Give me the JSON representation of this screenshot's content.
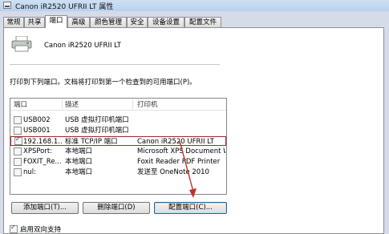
{
  "window": {
    "title": "Canon iR2520 UFRII LT 属性"
  },
  "tabs": [
    {
      "label": "常规"
    },
    {
      "label": "共享"
    },
    {
      "label": "端口"
    },
    {
      "label": "高级"
    },
    {
      "label": "颜色管理"
    },
    {
      "label": "安全"
    },
    {
      "label": "设备设置"
    },
    {
      "label": "配置文件"
    }
  ],
  "active_tab": "端口",
  "printer": {
    "name": "Canon iR2520 UFRII LT"
  },
  "instructions": "打印到下列端口。文档将打印到第一个检查到的可用端口(P)。",
  "port_list": {
    "columns": [
      "端口",
      "描述",
      "打印机"
    ],
    "rows": [
      {
        "port": "USB002",
        "desc": "USB 虚拟打印机端口",
        "printer": "",
        "checked": false
      },
      {
        "port": "USB001",
        "desc": "USB 虚拟打印机端口",
        "printer": "",
        "checked": false
      },
      {
        "port": "192.168.1....",
        "desc": "标准 TCP/IP 端口",
        "printer": "Canon iR2520 UFRII LT",
        "checked": true
      },
      {
        "port": "XPSPort:",
        "desc": "本地端口",
        "printer": "Microsoft XPS Document W",
        "checked": false
      },
      {
        "port": "FOXIT_Re...",
        "desc": "本地端口",
        "printer": "Foxit Reader PDF Printer",
        "checked": false
      },
      {
        "port": "nul:",
        "desc": "本地端口",
        "printer": "发送至 OneNote 2010",
        "checked": false
      }
    ]
  },
  "buttons": {
    "add_port": "添加端口(T)...",
    "delete_port": "删除端口(D)",
    "configure_port": "配置端口(C)..."
  },
  "bidirectional": {
    "label": "启用双向支持",
    "checked": true
  },
  "colors": {
    "highlight_border": "#a22a24",
    "arrow": "#c0302b"
  }
}
